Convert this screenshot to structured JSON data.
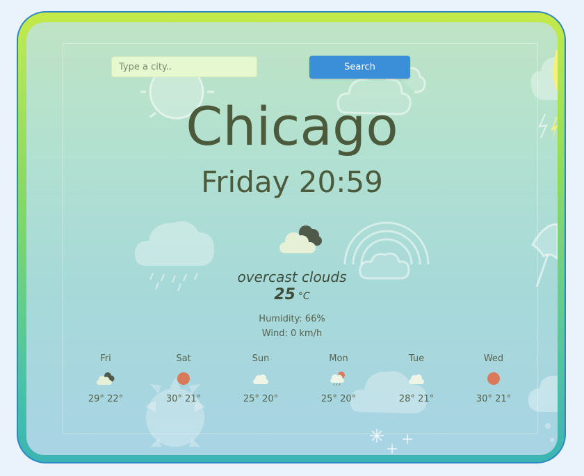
{
  "search": {
    "placeholder": "Type a city..",
    "value": "",
    "button_label": "Search"
  },
  "current": {
    "city": "Chicago",
    "day_time": "Friday 20:59",
    "icon": "overcast-clouds-icon",
    "description": "overcast clouds",
    "temperature": "25",
    "unit": "°C",
    "humidity": "Humidity: 66%",
    "wind": "Wind: 0 km/h"
  },
  "forecast": [
    {
      "day": "Fri",
      "icon": "overcast-clouds-icon",
      "temps": "29° 22°"
    },
    {
      "day": "Sat",
      "icon": "sun-icon",
      "temps": "30° 21°"
    },
    {
      "day": "Sun",
      "icon": "cloud-icon",
      "temps": "25° 20°"
    },
    {
      "day": "Mon",
      "icon": "sun-cloud-rain-icon",
      "temps": "25° 20°"
    },
    {
      "day": "Tue",
      "icon": "cloud-icon",
      "temps": "28° 21°"
    },
    {
      "day": "Wed",
      "icon": "sun-icon",
      "temps": "30° 21°"
    }
  ],
  "colors": {
    "accent": "#3b8fd8",
    "text": "#4b5a3b",
    "sun": "#d97a5a"
  }
}
